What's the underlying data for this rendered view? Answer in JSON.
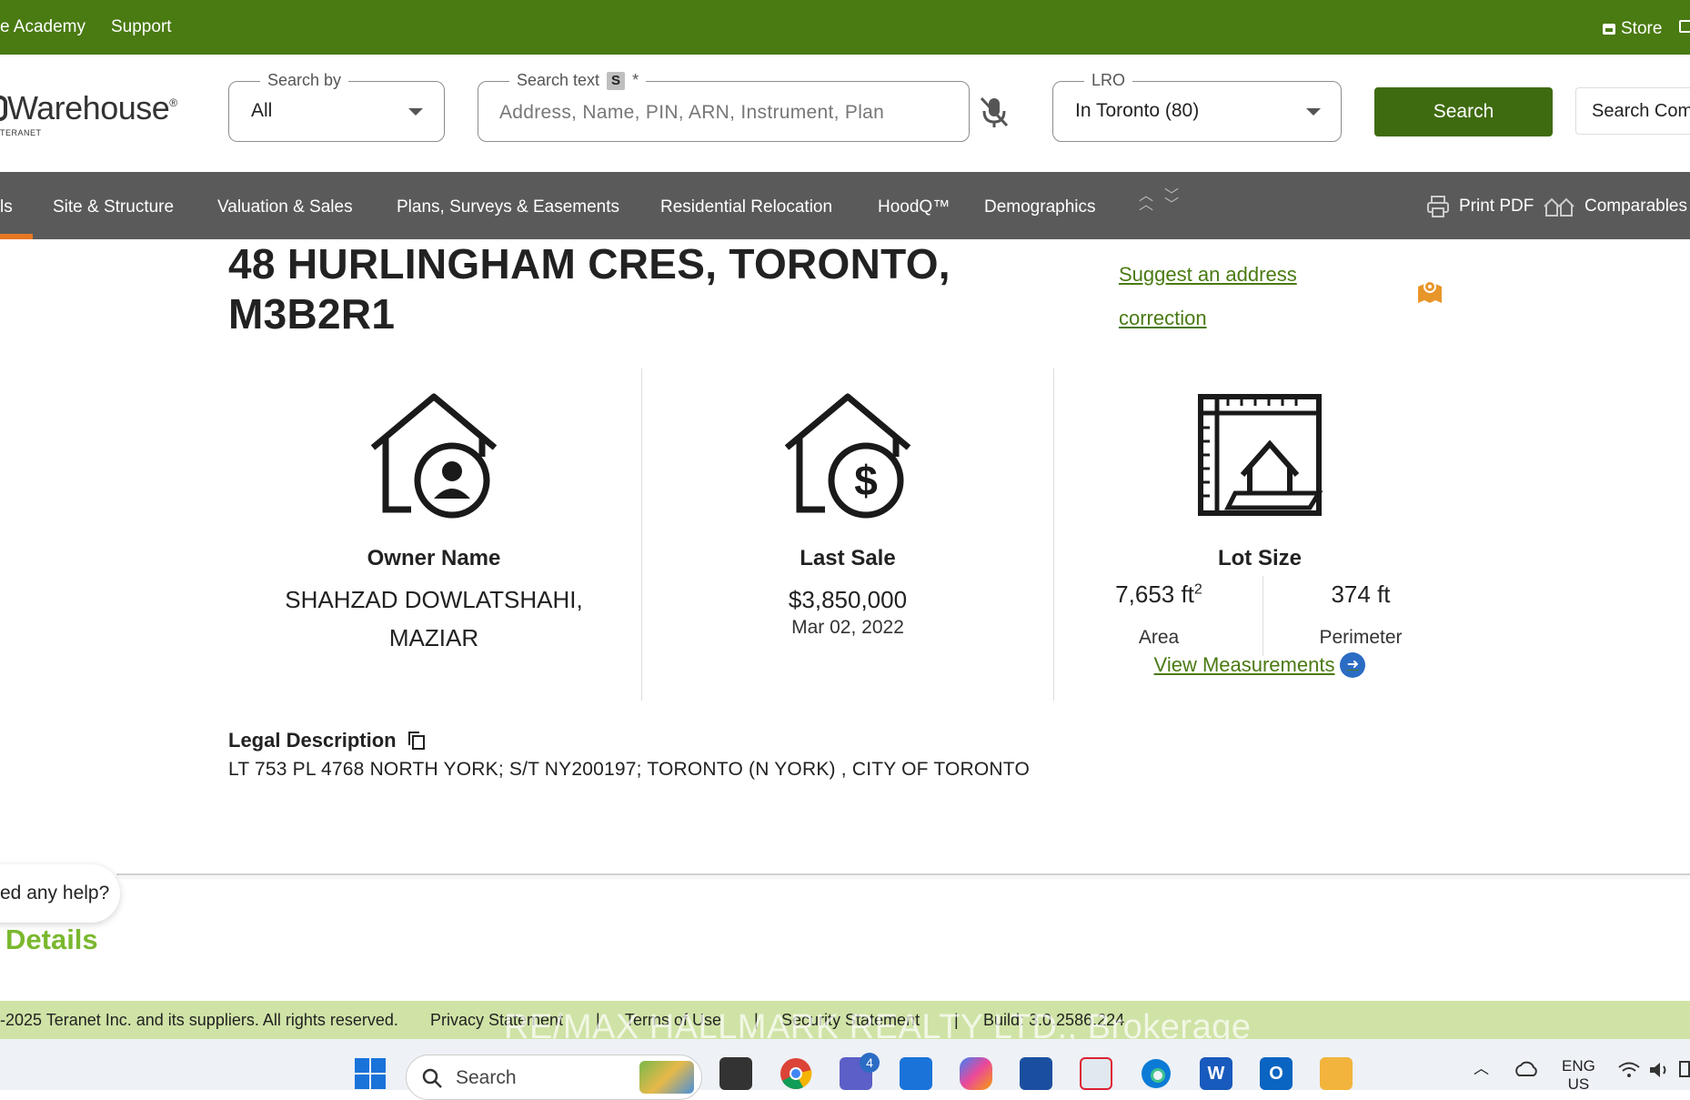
{
  "topbar": {
    "academy": "e Academy",
    "support": "Support",
    "store": "Store"
  },
  "header": {
    "logo": "Warehouse",
    "logo_sub": "TERANET",
    "search_by": {
      "legend": "Search by",
      "value": "All"
    },
    "search_text": {
      "legend": "Search text",
      "shortcut": "S",
      "required": "*",
      "placeholder": "Address, Name, PIN, ARN, Instrument, Plan"
    },
    "lro": {
      "legend": "LRO",
      "value": "In Toronto (80)"
    },
    "search_button": "Search",
    "search_com": "Search Com"
  },
  "nav": {
    "active_partial": "ls",
    "items": [
      "Site & Structure",
      "Valuation & Sales",
      "Plans, Surveys & Easements",
      "Residential Relocation",
      "HoodQ™",
      "Demographics"
    ],
    "print_pdf": "Print PDF",
    "comparables": "Comparables"
  },
  "property": {
    "address_line1": "48 HURLINGHAM CRES, TORONTO,",
    "address_line2": "M3B2R1",
    "suggest_line1": "Suggest an address",
    "suggest_line2": "correction"
  },
  "owner": {
    "label": "Owner Name",
    "line1": "SHAHZAD DOWLATSHAHI,",
    "line2": "MAZIAR"
  },
  "last_sale": {
    "label": "Last Sale",
    "price": "$3,850,000",
    "date": "Mar 02, 2022"
  },
  "lot": {
    "label": "Lot Size",
    "area": "7,653 ft",
    "area_exp": "2",
    "area_caption": "Area",
    "perimeter": "374 ft",
    "perimeter_caption": "Perimeter",
    "view_measurements": "View Measurements"
  },
  "legal": {
    "heading": "Legal Description",
    "text": "LT 753 PL 4768 NORTH YORK; S/T NY200197; TORONTO (N YORK) , CITY OF TORONTO"
  },
  "help": {
    "text": "ed any help?"
  },
  "details_heading": "Details",
  "footer": {
    "copyright": "-2025 Teranet Inc. and its suppliers. All rights reserved.",
    "privacy": "Privacy Statement",
    "terms": "Terms of Use",
    "security": "Security Statement",
    "build": "Build: 3.0.2586.224",
    "watermark": "RE/MAX HALLMARK REALTY LTD., Brokerage"
  },
  "taskbar": {
    "search": "Search",
    "teams_badge": "4",
    "lang1": "ENG",
    "lang2": "US"
  }
}
